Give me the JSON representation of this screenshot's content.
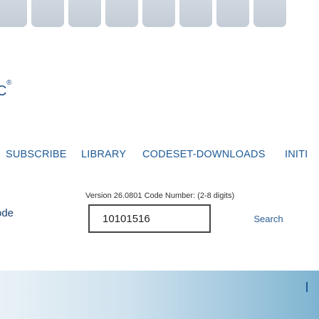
{
  "logo": {
    "text": "C",
    "registered": "®"
  },
  "nav": {
    "items": [
      "SUBSCRIBE",
      "LIBRARY",
      "CODESET-DOWNLOADS",
      "INITI"
    ]
  },
  "search": {
    "version_line": "Version 26.0801 Code Number: (2-8 digits)",
    "field_label": "ode",
    "code_value": "10101516",
    "button_label": "Search"
  },
  "colors": {
    "nav_text": "#1e5b96",
    "tile": "#c9d1db",
    "hero_start": "#e9f1f6",
    "hero_end": "#7eb4d1"
  }
}
